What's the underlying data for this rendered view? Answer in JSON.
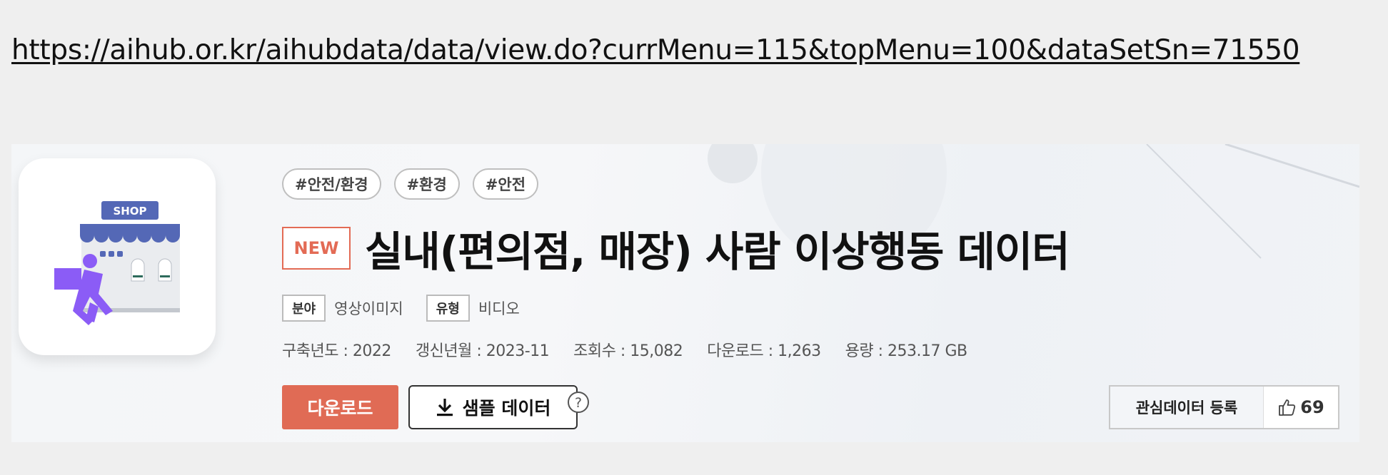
{
  "url": "https://aihub.or.kr/aihubdata/data/view.do?currMenu=115&topMenu=100&dataSetSn=71550",
  "icon": {
    "shop_sign": "SHOP"
  },
  "tags": [
    "#안전/환경",
    "#환경",
    "#안전"
  ],
  "badge": "NEW",
  "title": "실내(편의점, 매장) 사람 이상행동 데이터",
  "meta": {
    "field_key": "분야",
    "field_value": "영상이미지",
    "type_key": "유형",
    "type_value": "비디오"
  },
  "stats": [
    "구축년도 : 2022",
    "갱신년월 : 2023-11",
    "조회수 : 15,082",
    "다운로드 : 1,263",
    "용량 : 253.17 GB"
  ],
  "buttons": {
    "download": "다운로드",
    "sample": "샘플 데이터",
    "favorite": "관심데이터 등록",
    "likes": "69"
  },
  "colors": {
    "accent": "#e06b55",
    "icon_purple": "#8b5cf6",
    "awning_blue": "#5468b6"
  }
}
